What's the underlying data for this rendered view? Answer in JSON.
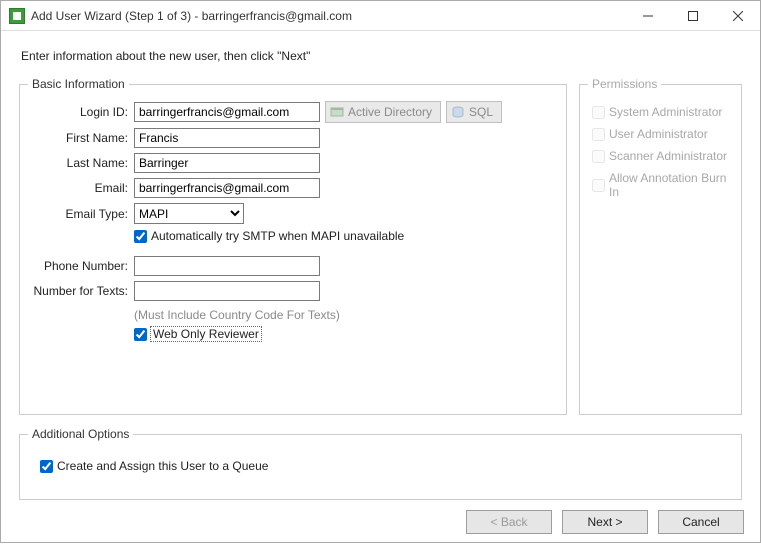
{
  "window": {
    "title": "Add User Wizard (Step 1 of 3) - barringerfrancis@gmail.com"
  },
  "instruction": "Enter information about the new user, then click \"Next\"",
  "basic": {
    "legend": "Basic Information",
    "labels": {
      "login": "Login ID:",
      "first": "First Name:",
      "last": "Last Name:",
      "email": "Email:",
      "emailType": "Email Type:",
      "phone": "Phone Number:",
      "texts": "Number for Texts:"
    },
    "values": {
      "login": "barringerfrancis@gmail.com",
      "first": "Francis",
      "last": "Barringer",
      "email": "barringerfrancis@gmail.com",
      "emailType": "MAPI",
      "phone": "",
      "texts": ""
    },
    "buttons": {
      "ad": "Active Directory",
      "sql": "SQL"
    },
    "smtpFallback": "Automatically try SMTP when MAPI unavailable",
    "textsHint": "(Must Include Country Code For Texts)",
    "webOnly": "Web Only Reviewer"
  },
  "permissions": {
    "legend": "Permissions",
    "items": [
      "System Administrator",
      "User Administrator",
      "Scanner Administrator",
      "Allow Annotation Burn In"
    ]
  },
  "additional": {
    "legend": "Additional Options",
    "queue": "Create and Assign this User to a Queue"
  },
  "footer": {
    "back": "< Back",
    "next": "Next >",
    "cancel": "Cancel"
  }
}
